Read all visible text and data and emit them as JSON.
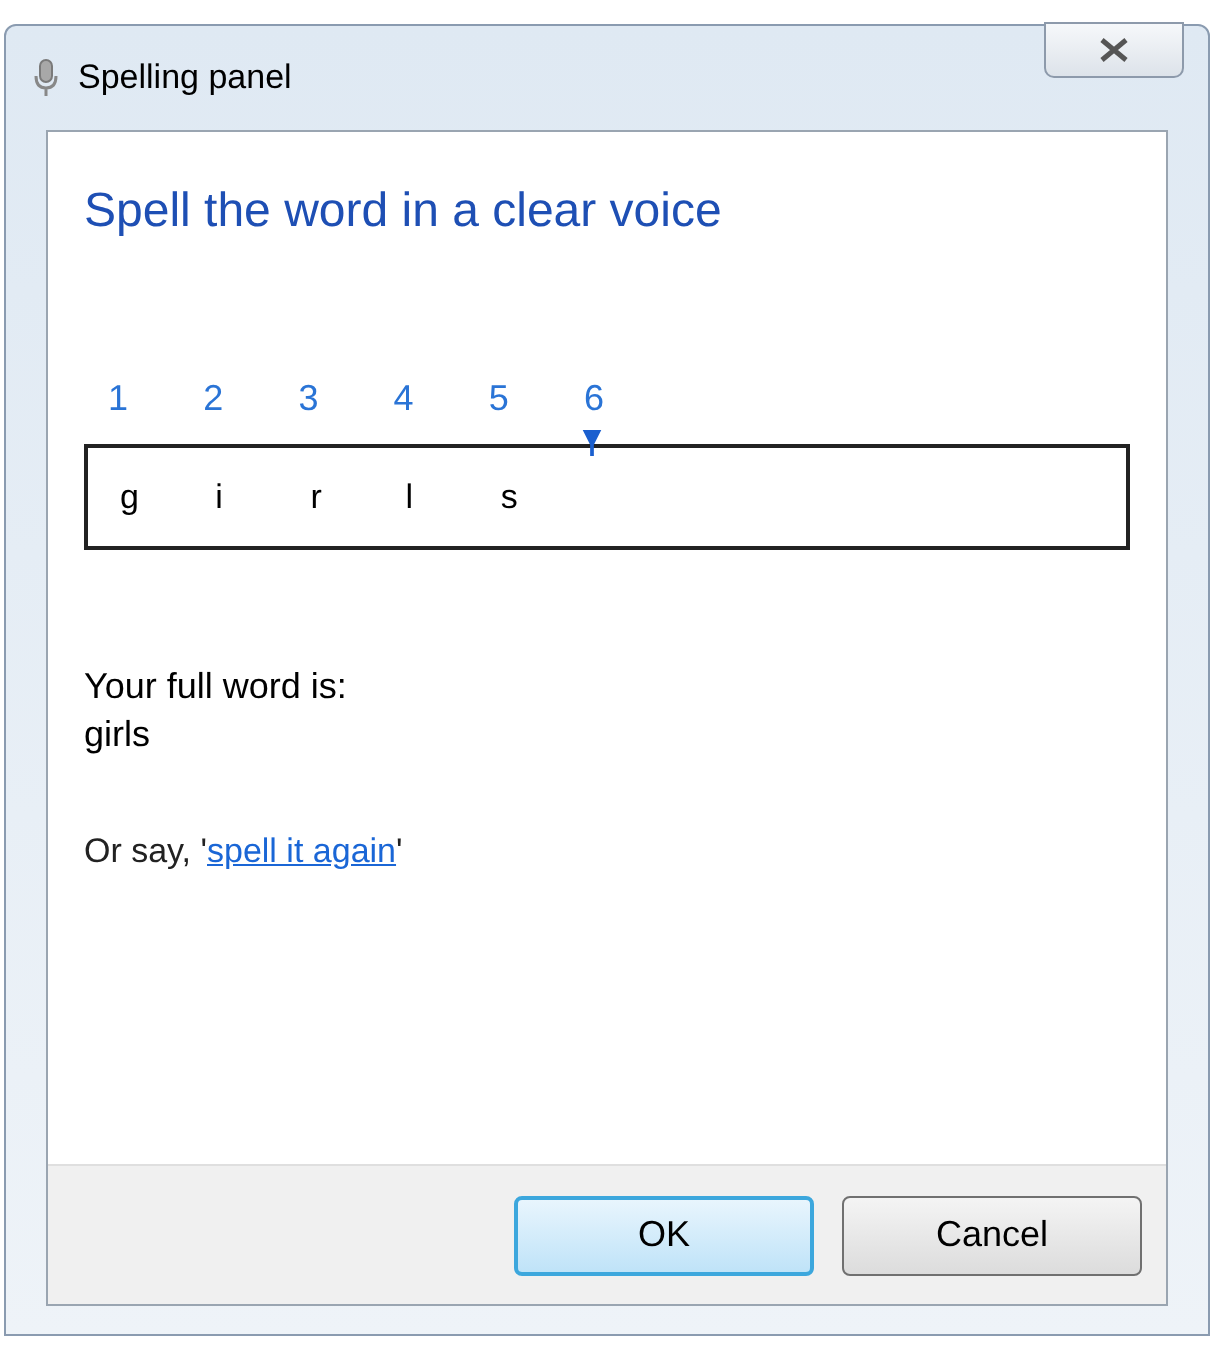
{
  "window": {
    "title": "Spelling panel"
  },
  "heading": "Spell the word in a clear voice",
  "positions": [
    {
      "number": "1",
      "letter": "g",
      "selected": false
    },
    {
      "number": "2",
      "letter": "i",
      "selected": false
    },
    {
      "number": "3",
      "letter": "r",
      "selected": false
    },
    {
      "number": "4",
      "letter": "l",
      "selected": false
    },
    {
      "number": "5",
      "letter": "s",
      "selected": false
    },
    {
      "number": "6",
      "selected": true
    }
  ],
  "full_word": {
    "label": "Your full word is:",
    "value": "girls"
  },
  "hint": {
    "prefix": "Or say, '",
    "link": "spell it again",
    "suffix": "'"
  },
  "buttons": [
    {
      "label": "OK",
      "default": true
    },
    {
      "label": "Cancel",
      "default": false
    }
  ]
}
